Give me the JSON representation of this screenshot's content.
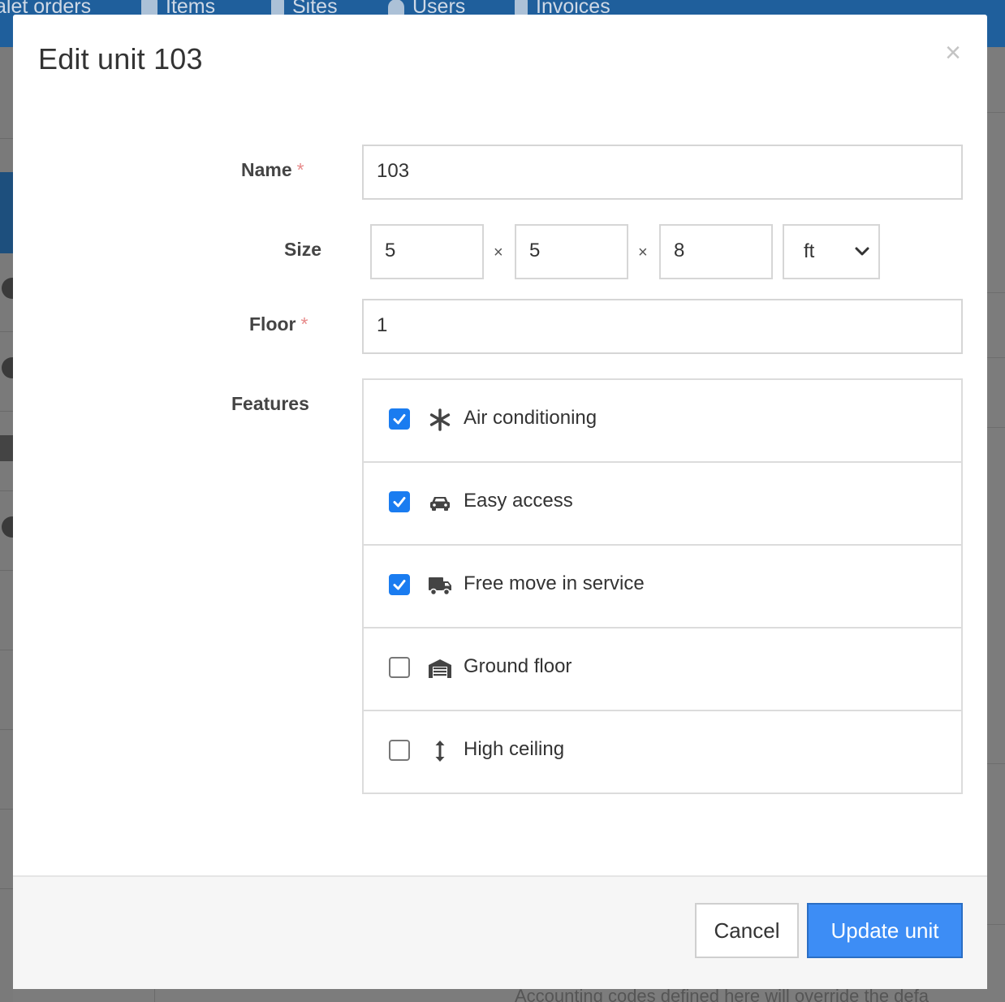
{
  "background": {
    "nav_items": [
      {
        "label": "alet orders",
        "icon": "tag-icon"
      },
      {
        "label": "Items",
        "icon": "box-icon"
      },
      {
        "label": "Sites",
        "icon": "building-icon"
      },
      {
        "label": "Users",
        "icon": "user-icon"
      },
      {
        "label": "Invoices",
        "icon": "invoice-icon"
      }
    ],
    "bottom_text": "Accounting codes defined here will override the defa"
  },
  "modal": {
    "title": "Edit unit 103",
    "close_glyph": "×",
    "required_mark": "*",
    "name": {
      "label": "Name",
      "value": "103"
    },
    "size": {
      "label": "Size",
      "width": "5",
      "length": "5",
      "height": "8",
      "separator": "×",
      "unit_selected": "ft"
    },
    "floor": {
      "label": "Floor",
      "value": "1"
    },
    "features": {
      "label": "Features",
      "items": [
        {
          "label": "Air conditioning",
          "checked": true,
          "icon": "snowflake-asterisk-icon"
        },
        {
          "label": "Easy access",
          "checked": true,
          "icon": "car-icon"
        },
        {
          "label": "Free move in service",
          "checked": true,
          "icon": "truck-icon"
        },
        {
          "label": "Ground floor",
          "checked": false,
          "icon": "garage-icon"
        },
        {
          "label": "High ceiling",
          "checked": false,
          "icon": "arrows-vertical-icon"
        }
      ]
    },
    "buttons": {
      "cancel": "Cancel",
      "update": "Update unit"
    }
  },
  "colors": {
    "primary": "#3d8df5",
    "checkbox_checked": "#1a7cf0",
    "required": "#e78a8a",
    "nav_bg": "#1f5f9c"
  }
}
